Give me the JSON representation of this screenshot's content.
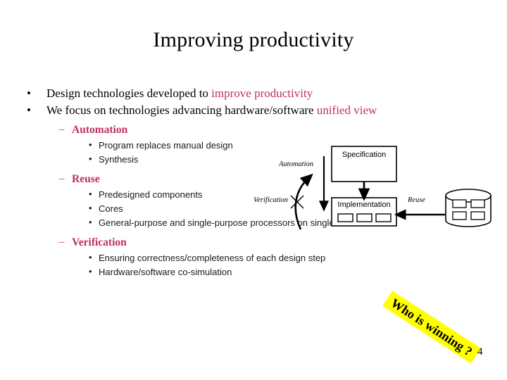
{
  "slide": {
    "title": "Improving productivity",
    "page_number": "4",
    "accent_color": "#C0305A",
    "banner_color": "#FFFF00"
  },
  "bullets": {
    "b1": {
      "marker": "•",
      "text_plain": "Design technologies developed to ",
      "text_accent": "improve productivity"
    },
    "b2": {
      "marker": "•",
      "text_plain": "We focus on technologies advancing hardware/software ",
      "text_accent": "unified view"
    },
    "automation": {
      "marker": "–",
      "label": "Automation",
      "items": [
        {
          "marker": "•",
          "text": "Program replaces manual design"
        },
        {
          "marker": "•",
          "text": "Synthesis"
        }
      ]
    },
    "reuse": {
      "marker": "–",
      "label": "Reuse",
      "items": [
        {
          "marker": "•",
          "text": "Predesigned components"
        },
        {
          "marker": "•",
          "text": "Cores"
        },
        {
          "marker": "•",
          "text": "General-purpose and single-purpose processors on single IC"
        }
      ]
    },
    "verification": {
      "marker": "–",
      "label": "Verification",
      "items": [
        {
          "marker": "•",
          "text": "Ensuring correctness/completeness of each design step"
        },
        {
          "marker": "•",
          "text": "Hardware/software co-simulation"
        }
      ]
    }
  },
  "diagram": {
    "spec_box_label": "Specification",
    "impl_box_label": "Implementation",
    "automation_label": "Automation",
    "verification_label": "Verification",
    "reuse_label": "Reuse"
  },
  "banner": {
    "text": "Who is winning ?"
  }
}
